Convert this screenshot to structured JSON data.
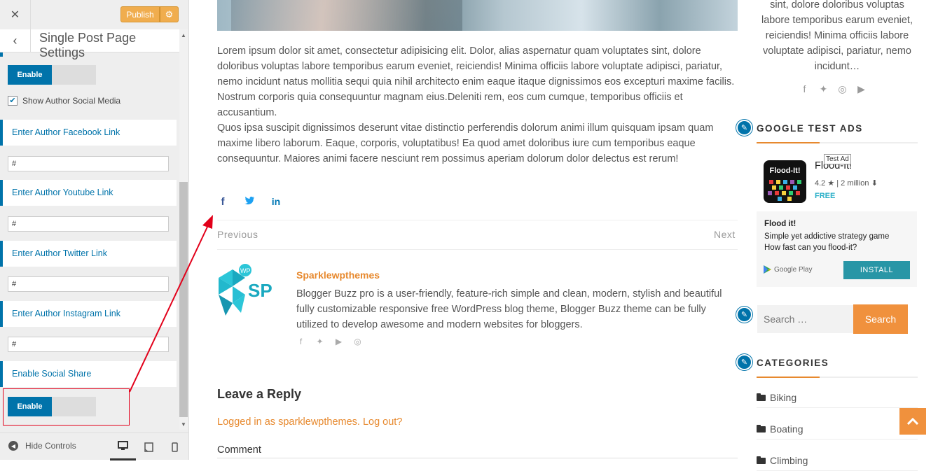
{
  "customizer": {
    "close_icon": "✕",
    "publish_label": "Publish",
    "gear_icon": "⚙",
    "back_icon": "‹",
    "section_title": "Single Post Page Settings",
    "toggle_author": "Enable",
    "show_author_social_label": "Show Author Social Media",
    "fields": [
      {
        "label": "Enter Author Facebook Link",
        "value": "#"
      },
      {
        "label": "Enter Author Youtube Link",
        "value": "#"
      },
      {
        "label": "Enter Author Twitter Link",
        "value": "#"
      },
      {
        "label": "Enter Author Instagram Link",
        "value": "#"
      }
    ],
    "social_share_label": "Enable Social Share",
    "toggle_share": "Enable",
    "hide_controls": "Hide Controls"
  },
  "post": {
    "paragraph_1": "Lorem ipsum dolor sit amet, consectetur adipisicing elit. Dolor, alias aspernatur quam voluptates sint, dolore doloribus voluptas labore temporibus earum eveniet, reiciendis! Minima officiis labore voluptate adipisci, pariatur, nemo incidunt natus mollitia sequi quia nihil architecto enim eaque itaque dignissimos eos excepturi maxime facilis. Nostrum corporis quia consequuntur magnam eius.Deleniti rem, eos cum cumque, temporibus officiis et accusantium.",
    "paragraph_2": "Quos ipsa suscipit dignissimos deserunt vitae distinctio perferendis dolorum animi illum quisquam ipsam quam maxime libero laborum. Eaque, corporis, voluptatibus! Ea quod amet doloribus iure cum temporibus eaque consequuntur. Maiores animi facere nesciunt rem possimus aperiam dolorum dolor delectus est rerum!",
    "share_icons": [
      "f",
      "🐦",
      "in"
    ],
    "previous": "Previous",
    "next": "Next"
  },
  "author": {
    "logo_text": "SP",
    "logo_badge": "WP",
    "name": "Sparklewpthemes",
    "bio": "Blogger Buzz pro is a user-friendly, feature-rich simple and clean, modern, stylish and beautiful fully customizable responsive free WordPress blog theme, Blogger Buzz theme can be fully utilized to develop awesome and modern websites for bloggers.",
    "social_icons": [
      "f",
      "🐦",
      "▶",
      "◎"
    ]
  },
  "reply": {
    "title": "Leave a Reply",
    "logged_in": "Logged in as sparklewpthemes. Log out?",
    "comment_label": "Comment"
  },
  "sidebar": {
    "about_text": "sint, dolore doloribus voluptas labore temporibus earum eveniet, reiciendis! Minima officiis labore voluptate adipisci, pariatur, nemo incidunt…",
    "social_icons": [
      "f",
      "🐦",
      "◎",
      "▶"
    ],
    "ads_title": "GOOGLE TEST ADS",
    "ad": {
      "tag": "Test Ad",
      "icon_text": "Flood-It!",
      "app_name": "Flood-It!",
      "rating": "4.2 ★ | 2 million ⬇",
      "price": "FREE",
      "headline": "Flood it!",
      "desc_1": "Simple yet addictive strategy game",
      "desc_2": "How fast can you flood-it?",
      "store": "Google Play",
      "install": "INSTALL"
    },
    "search_placeholder": "Search …",
    "search_button": "Search",
    "categories_title": "CATEGORIES",
    "categories": [
      "Biking",
      "Boating",
      "Climbing"
    ]
  },
  "colors": {
    "accent": "#e7892e",
    "customizer_blue": "#0073aa",
    "annotation_red": "#e2001a"
  }
}
